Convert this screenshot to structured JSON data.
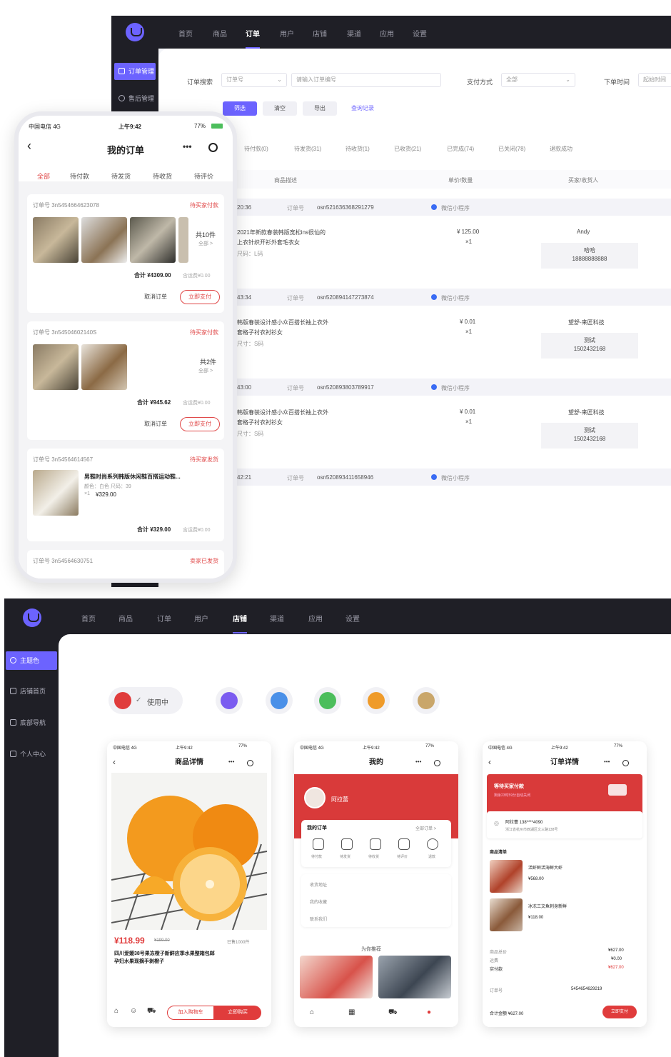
{
  "admin_top": {
    "nav": [
      "首页",
      "商品",
      "订单",
      "用户",
      "店铺",
      "渠道",
      "应用",
      "设置"
    ],
    "nav_active": 2,
    "sidebar": [
      "订单管理",
      "售后管理"
    ],
    "filters": {
      "order_search_label": "订单搜索",
      "order_type_value": "订单号",
      "order_search_placeholder": "请输入订单编号",
      "payment_label": "支付方式",
      "payment_value": "全部",
      "order_time_label": "下单时间",
      "date_placeholder": "起始时间"
    },
    "actions": [
      "筛选",
      "清空",
      "导出",
      "查询记录"
    ],
    "status_tabs": [
      "待付款(0)",
      "待发货(31)",
      "待收货(1)",
      "已收货(21)",
      "已完成(74)",
      "已关闭(78)",
      "退款成功"
    ],
    "table_headers": [
      "商品描述",
      "单价/数量",
      "买家/收货人"
    ],
    "orders": [
      {
        "time": "20:36",
        "order_label": "订单号",
        "order_no": "osn521636368291279",
        "channel": "微信小程序",
        "desc_line1": "2021年新款春装韩版宽松ins很仙的",
        "desc_line2": "上衣针织开衫外套毛衣女",
        "desc_line3": "尺码：L码",
        "price": "¥ 125.00",
        "qty": "×1",
        "buyer": "Andy",
        "receiver_name": "哈哈",
        "receiver_phone": "18888888888"
      },
      {
        "time": "43:34",
        "order_label": "订单号",
        "order_no": "osn520894147273874",
        "channel": "微信小程序",
        "desc_line1": "韩版春装设计感小众百搭长袖上衣外",
        "desc_line2": "套格子衬衣衬衫女",
        "desc_line3": "尺寸：S码",
        "price": "¥ 0.01",
        "qty": "×1",
        "buyer": "望舒-来匠科技",
        "receiver_name": "测试",
        "receiver_phone": "15024321​68"
      },
      {
        "time": "43:00",
        "order_label": "订单号",
        "order_no": "osn520893803789917",
        "channel": "微信小程序",
        "desc_line1": "韩版春装设计感小众百搭长袖上衣外",
        "desc_line2": "套格子衬衣衬衫女",
        "desc_line3": "尺寸：S码",
        "price": "¥ 0.01",
        "qty": "×1",
        "buyer": "望舒-来匠科技",
        "receiver_name": "测试",
        "receiver_phone": "1502432168"
      },
      {
        "time": "42:21",
        "order_label": "订单号",
        "order_no": "osn520893411658946",
        "channel": "微信小程序"
      }
    ]
  },
  "phone_orders": {
    "carrier": "中国电信 4G",
    "time": "上午9:42",
    "battery": "77%",
    "title": "我的订单",
    "tabs": [
      "全部",
      "待付款",
      "待发货",
      "待收货",
      "待评价"
    ],
    "tab_active": 0,
    "orders": [
      {
        "order_no": "订单号 3n5454664623078",
        "status": "待买家付款",
        "summary": "共10件",
        "summary_sub": "全部 >",
        "total": "合计 ¥4309.00",
        "total_note": "含运费¥0.00",
        "btn_cancel": "取消订单",
        "btn_pay": "立即支付"
      },
      {
        "order_no": "订单号 3n54504602140S",
        "status": "待买家付款",
        "summary": "共2件",
        "summary_sub": "全部 >",
        "total": "合计 ¥945.62",
        "total_note": "含运费¥0.00",
        "btn_cancel": "取消订单",
        "btn_pay": "立即支付"
      },
      {
        "order_no": "订单号 3n54564614567",
        "status": "待买家发货",
        "product_name": "男鞋时尚系列韩版休闲鞋百搭运动鞋...",
        "product_spec": "颜色：白色 尺码：39",
        "product_price": "¥329.00",
        "product_qty": "×1",
        "total": "合计 ¥329.00",
        "total_note": "含运费¥0.00"
      },
      {
        "order_no": "订单号 3n54564630751",
        "status": "卖家已发货"
      }
    ]
  },
  "admin_bottom": {
    "nav": [
      "首页",
      "商品",
      "订单",
      "用户",
      "店铺",
      "渠道",
      "应用",
      "设置"
    ],
    "nav_active": 4,
    "sidebar": [
      "主题色",
      "店铺首页",
      "底部导航",
      "个人中心"
    ],
    "theme_in_use": "使用中",
    "theme_colors": [
      "#e03c3c",
      "#7b5cf0",
      "#4a90e8",
      "#4cbe5c",
      "#ef9b2a",
      "#c9a66a"
    ],
    "phones": {
      "status_carrier": "中国电信 4G",
      "status_time": "上午9:42",
      "status_battery": "77%",
      "product": {
        "title": "商品详情",
        "price": "¥118.99",
        "price_old": "¥199.00",
        "sales": "已售1000件",
        "name": "四川爱媛38号果冻橙子新鲜应季水果整箱包邮",
        "name_line2": "孕妇水果现摘手剥橙子",
        "btn_cart": "加入购物车",
        "btn_buy": "立即购买"
      },
      "profile": {
        "title": "我的",
        "user": "阿拉蕾",
        "my_orders": "我的订单",
        "all_orders": "全部订单 >",
        "order_icons": [
          "待付款",
          "待发货",
          "待收货",
          "待评价",
          "退款"
        ],
        "menu": [
          "收货地址",
          "我的收藏",
          "联系我们"
        ],
        "recommend": "为你推荐"
      },
      "detail": {
        "title": "订单详情",
        "banner_title": "等待买家付款",
        "banner_sub": "剩余23时59分自动关闭",
        "address_name": "阿拉蕾 138****4090",
        "address_line": "浙江省杭州市西湖区文三路138号",
        "goods_label": "商品清单",
        "goods": [
          {
            "name": "活虾鲜活海鲜大虾",
            "price": "¥568.00"
          },
          {
            "name": "冰冻三文鱼刺身新鲜",
            "price": "¥118.00"
          }
        ],
        "subtotal_label": "商品总价",
        "subtotal": "¥627.00",
        "shipping_label": "运费",
        "shipping": "¥0.00",
        "paid_label": "实付款",
        "paid": "¥627.00",
        "order_no_label": "订单号",
        "order_no": "5454654629219",
        "footer_total": "合计金额 ¥627.00",
        "btn_pay": "立即支付"
      }
    }
  }
}
